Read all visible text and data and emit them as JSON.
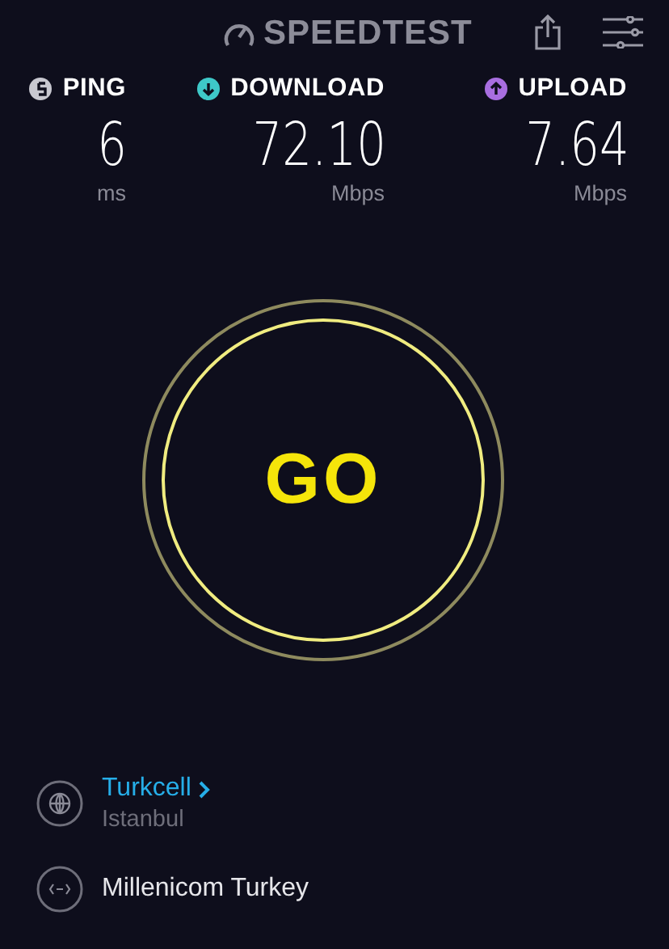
{
  "header": {
    "logo": "SPEEDTEST"
  },
  "metrics": [
    {
      "label": "PING",
      "value": "6",
      "unit": "ms",
      "color": "#c8c8d0",
      "kind": "ping"
    },
    {
      "label": "DOWNLOAD",
      "value": "72.10",
      "unit": "Mbps",
      "color": "#3ec8c8",
      "kind": "download"
    },
    {
      "label": "UPLOAD",
      "value": "7.64",
      "unit": "Mbps",
      "color": "#a86ee0",
      "kind": "upload"
    }
  ],
  "go_button": {
    "label": "GO"
  },
  "provider": {
    "name": "Turkcell",
    "location": "Istanbul"
  },
  "server": {
    "name": "Millenicom Turkey"
  }
}
